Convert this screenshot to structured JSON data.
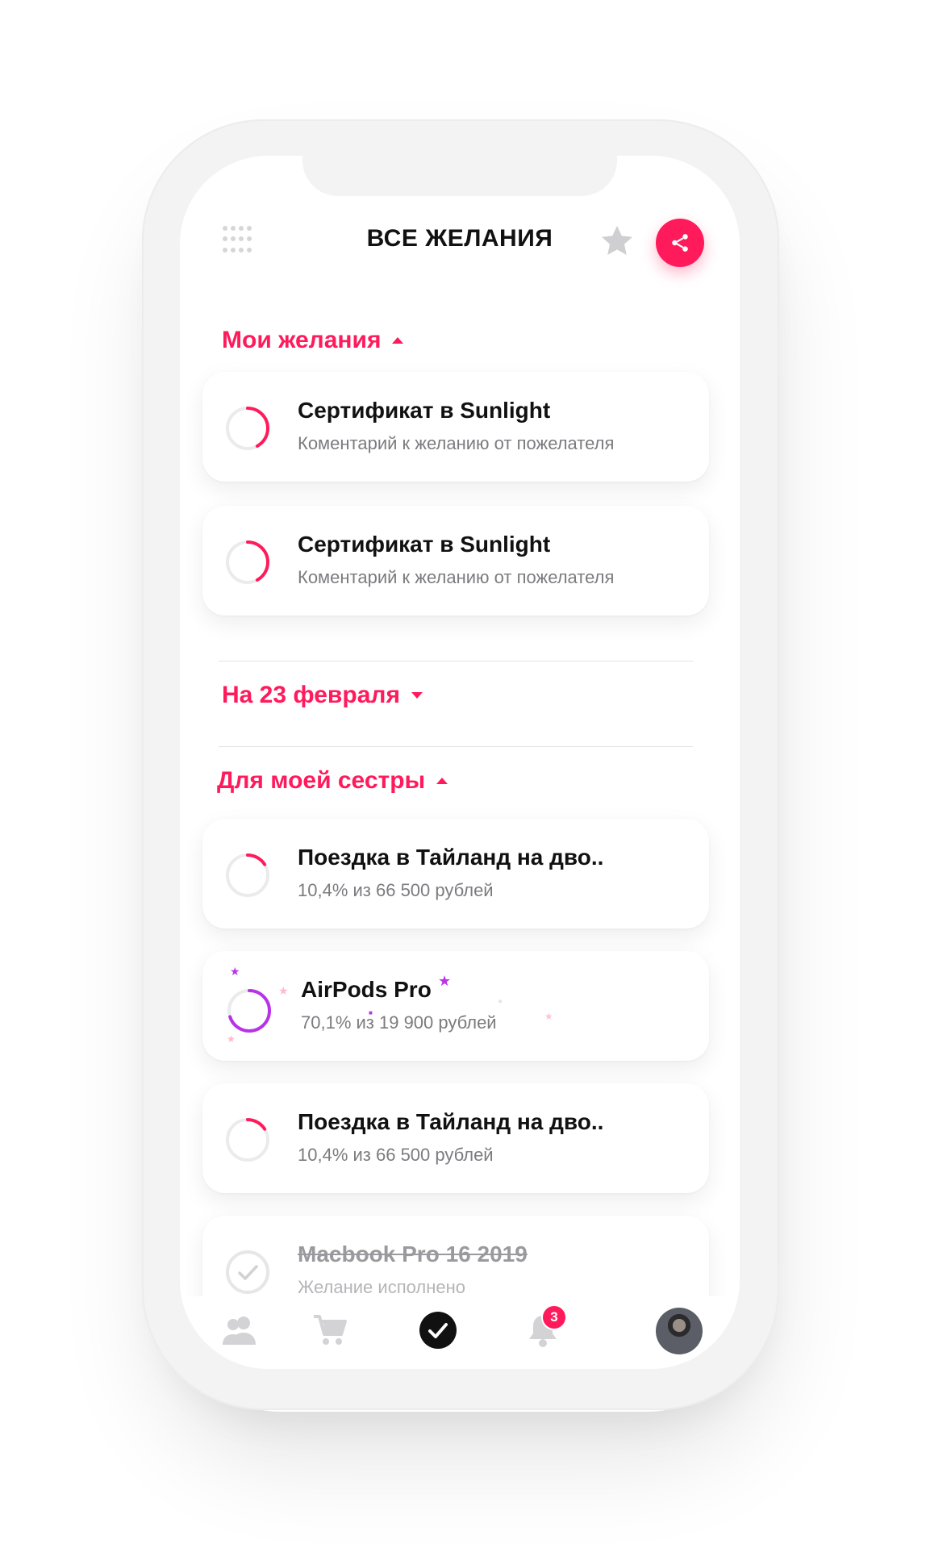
{
  "app": {
    "title": "ВСЕ ЖЕЛАНИЯ",
    "accent_color": "#ff1a5b",
    "secondary_accent": "#b833e8"
  },
  "header": {
    "menu_icon": "grid-dots-icon",
    "favorite_icon": "star-icon",
    "share_icon": "share-icon"
  },
  "sections": [
    {
      "title": "Мои желания",
      "expanded": true,
      "items": [
        {
          "title": "Сертификат в Sunlight",
          "subtitle": "Коментарий к желанию от пожелателя",
          "progress": 0.42,
          "color": "#ff1a5b"
        },
        {
          "title": "Сертификат в Sunlight",
          "subtitle": "Коментарий к желанию от пожелателя",
          "progress": 0.42,
          "color": "#ff1a5b"
        }
      ]
    },
    {
      "title": "На 23 февраля",
      "expanded": false,
      "items": []
    },
    {
      "title": "Для моей сестры",
      "expanded": true,
      "items": [
        {
          "title": "Поездка в Тайланд на дво..",
          "subtitle": "10,4% из 66 500 рублей",
          "progress": 0.104,
          "color": "#ff1a5b"
        },
        {
          "title": "AirPods Pro",
          "subtitle": "70,1% из 19 900 рублей",
          "progress": 0.701,
          "color": "#b833e8"
        },
        {
          "title": "Поездка в Тайланд на дво..",
          "subtitle": "10,4% из 66 500 рублей",
          "progress": 0.104,
          "color": "#ff1a5b"
        },
        {
          "title": "Macbook Pro 16 2019",
          "subtitle": "Желание исполнено",
          "done": true
        }
      ]
    }
  ],
  "tabbar": {
    "tabs": [
      "friends-icon",
      "cart-icon",
      "wishes-check-icon",
      "notifications-bell-icon",
      "profile-avatar"
    ],
    "active": "wishes-check-icon",
    "notifications_count": "3"
  }
}
